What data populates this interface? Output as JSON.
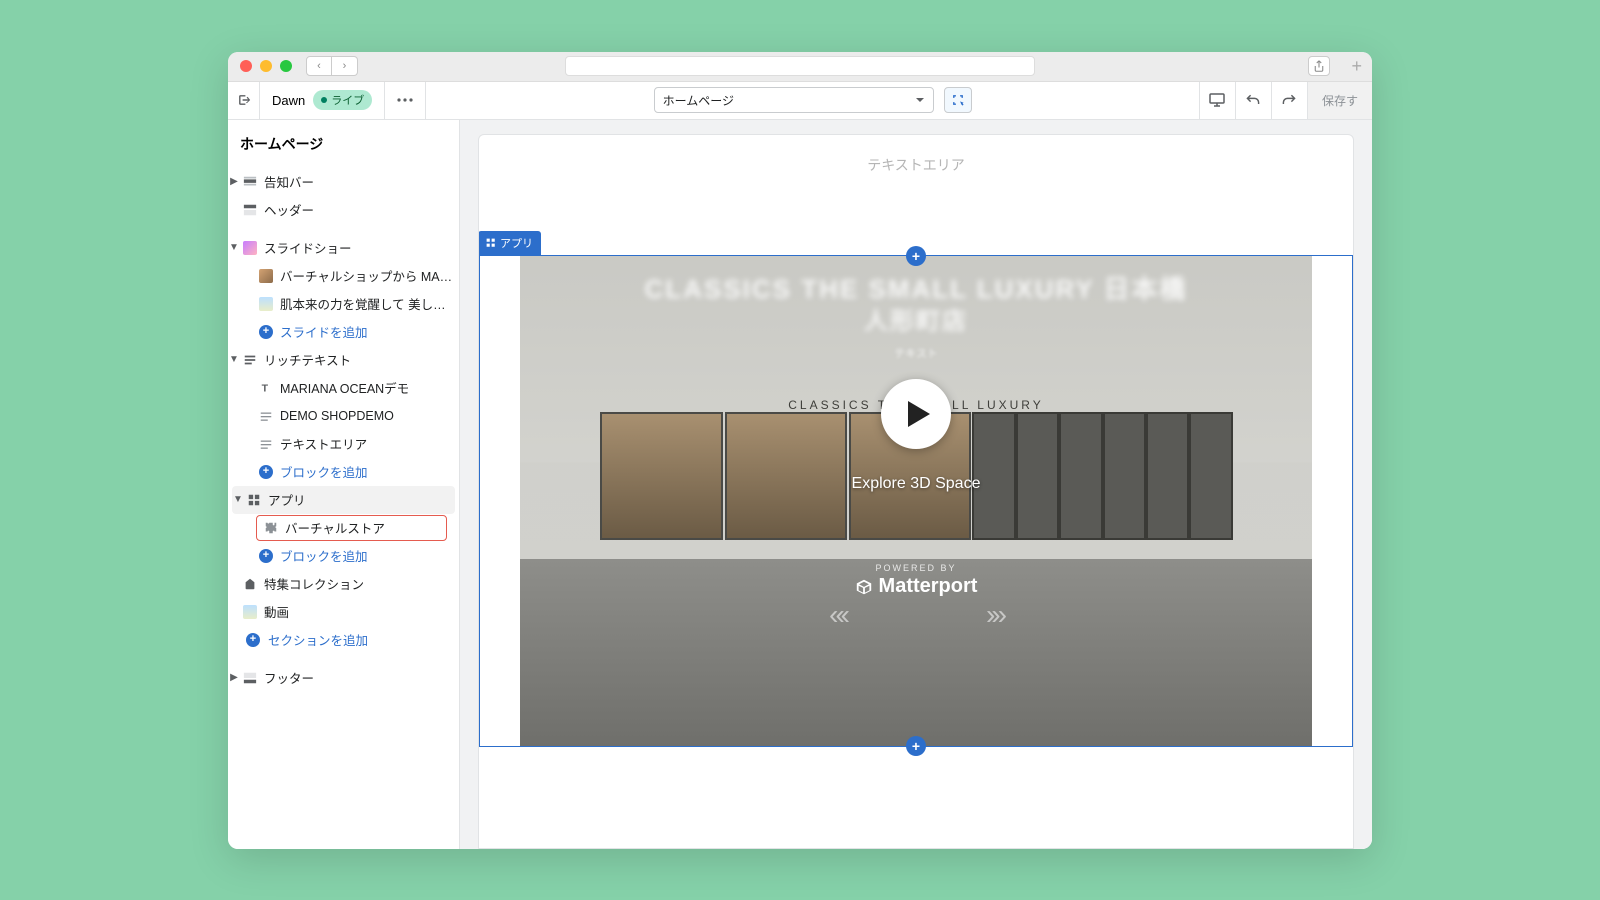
{
  "browser": {
    "back": "‹",
    "fwd": "›",
    "share": "⇪",
    "add": "+"
  },
  "topbar": {
    "theme_name": "Dawn",
    "status": "ライブ",
    "page_selector": "ホームページ",
    "save": "保存す"
  },
  "sidebar": {
    "title": "ホームページ",
    "announcement": "告知バー",
    "header": "ヘッダー",
    "slideshow": {
      "label": "スライドショー",
      "slide1": "バーチャルショップから MARI…",
      "slide2": "肌本来の力を覚醒して 美しさ…",
      "add": "スライドを追加"
    },
    "richtext": {
      "label": "リッチテキスト",
      "b1": "MARIANA OCEANデモ",
      "b2": "DEMO SHOPDEMO",
      "b3": "テキストエリア",
      "add": "ブロックを追加"
    },
    "apps": {
      "label": "アプリ",
      "b1": "バーチャルストア",
      "add": "ブロックを追加"
    },
    "featured": "特集コレクション",
    "video": "動画",
    "addsection": "セクションを追加",
    "footer": "フッター"
  },
  "preview": {
    "textarea": "テキストエリア",
    "apptag": "アプリ",
    "signage": "CLASSICS THE SMALL LUXURY",
    "title1": "CLASSICS THE SMALL LUXURY 日本橋",
    "title2": "人形町店",
    "subtext": "テキスト",
    "explore": "Explore 3D Space",
    "powered": "POWERED BY",
    "brand": "Matterport"
  }
}
